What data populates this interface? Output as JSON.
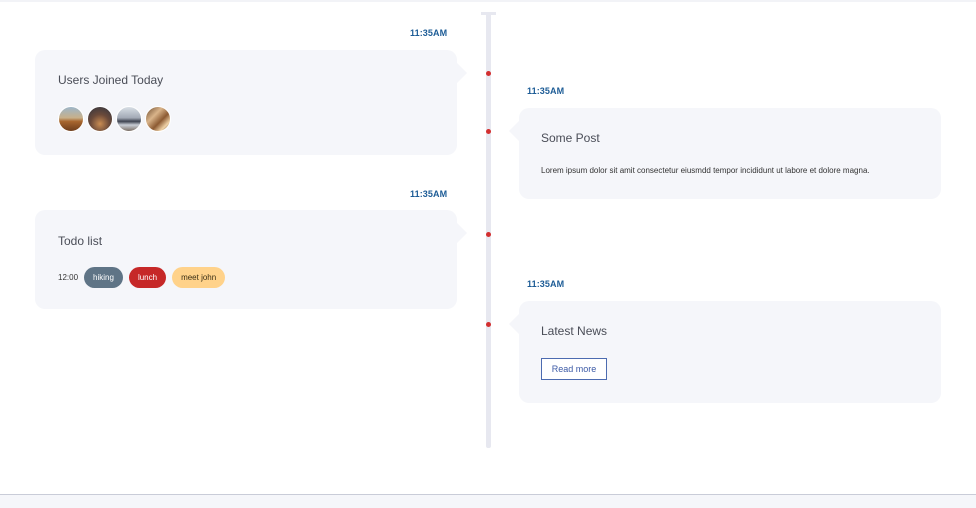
{
  "timeline": {
    "items": [
      {
        "time": "11:35AM",
        "title": "Users Joined Today",
        "avatars": [
          "user-avatar-1",
          "user-avatar-2",
          "user-avatar-3",
          "user-avatar-4"
        ]
      },
      {
        "time": "11:35AM",
        "title": "Some Post",
        "body": "Lorem ipsum dolor sit amit consectetur eiusmdd tempor incididunt ut labore et dolore magna."
      },
      {
        "time": "11:35AM",
        "title": "Todo list",
        "todo_time": "12:00",
        "tags": [
          "hiking",
          "lunch",
          "meet john"
        ]
      },
      {
        "time": "11:35AM",
        "title": "Latest News",
        "button_label": "Read more"
      }
    ]
  },
  "colors": {
    "accent_time": "#1d5c96",
    "dot": "#d32f2f",
    "card_bg": "#f5f6fa",
    "tag_hiking": "#5f7486",
    "tag_lunch": "#c62828",
    "tag_meet": "#ffd28a"
  }
}
